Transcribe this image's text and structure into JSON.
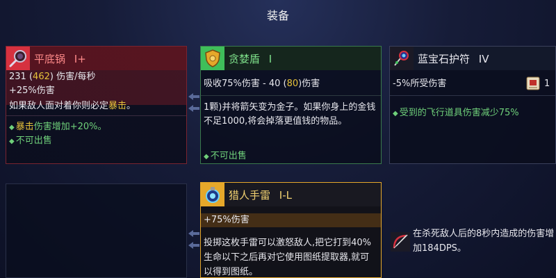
{
  "screen": {
    "title": "装备"
  },
  "cards": {
    "frying_pan": {
      "name": "平底锅",
      "tier": "I+",
      "dps_base": "231",
      "dps_total": "462",
      "dps_label": "伤害/每秒",
      "stat": "+25%伤害",
      "desc_prefix": "如果敌人面对着你则必定",
      "desc_highlight": "暴击",
      "desc_suffix": "。",
      "bullet1_highlight": "暴击",
      "bullet1_text": "伤害增加+20%。",
      "bullet2": "不可出售"
    },
    "greed_shield": {
      "name": "贪婪盾",
      "tier": "I",
      "stat_prefix": "吸收75%伤害 - 40 (",
      "stat_value": "80",
      "stat_suffix": ")伤害",
      "desc": "1颗)并将箭矢变为金子。如果你身上的金钱不足1000,将会掉落更值钱的物品。",
      "bullet": "不可出售"
    },
    "sapphire_amulet": {
      "name": "蓝宝石护符",
      "tier": "IV",
      "stat": "-5%所受伤害",
      "scroll_count": "1",
      "bullet": "受到的飞行道具伤害减少75%"
    },
    "hunter_grenade": {
      "name": "猎人手雷",
      "tier": "I-L",
      "stat": "+75%伤害",
      "desc": "投掷这枚手雷可以激怒敌人,把它打到40%生命以下之后再对它使用图纸提取器,就可以得到图纸。"
    },
    "bow_perk": {
      "text": "在杀死敌人后的8秒内造成的伤害增加184DPS。"
    }
  },
  "colors": {
    "red_accent": "#d6313f",
    "green_accent": "#3fbf5a",
    "gold_accent": "#e6a82a",
    "yellow_text": "#e6c23a",
    "green_text": "#6fd07a"
  }
}
